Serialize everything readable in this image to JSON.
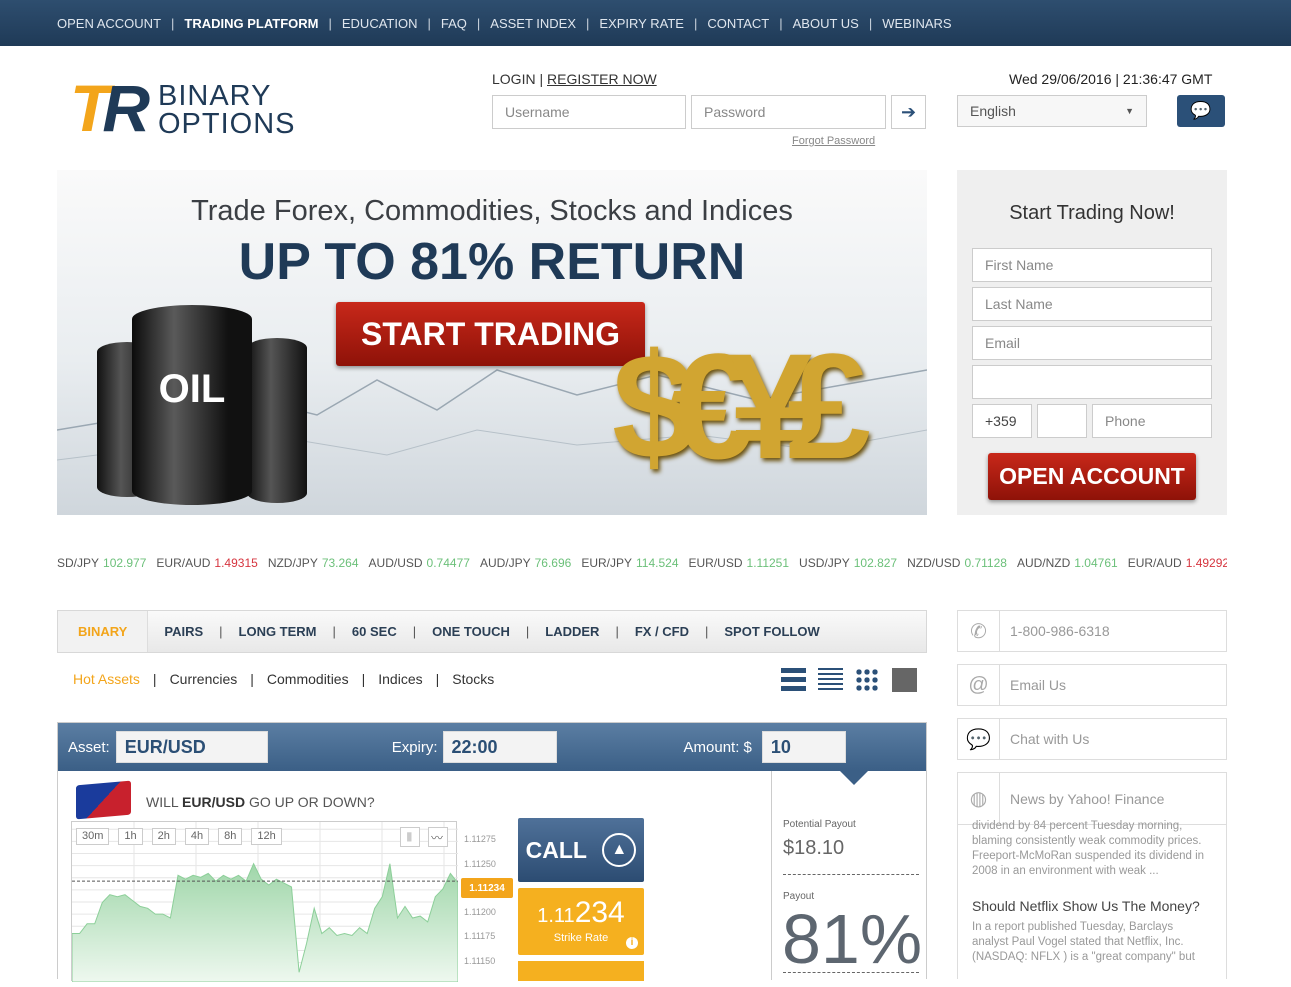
{
  "nav": {
    "items": [
      "OPEN ACCOUNT",
      "TRADING PLATFORM",
      "EDUCATION",
      "FAQ",
      "ASSET INDEX",
      "EXPIRY RATE",
      "CONTACT",
      "ABOUT US",
      "WEBINARS"
    ],
    "active": "TRADING PLATFORM"
  },
  "logo": {
    "mark": "TR",
    "line1": "BINARY",
    "line2": "OPTIONS"
  },
  "login": {
    "login_label": "LOGIN",
    "register_label": "REGISTER NOW",
    "username_placeholder": "Username",
    "password_placeholder": "Password",
    "forgot": "Forgot Password"
  },
  "header": {
    "datetime": "Wed 29/06/2016 | 21:36:47 GMT",
    "language": "English"
  },
  "banner": {
    "headline": "Trade Forex, Commodities, Stocks and Indices",
    "return": "UP TO 81% RETURN",
    "cta": "START TRADING",
    "oil_label": "OIL"
  },
  "signup": {
    "title": "Start Trading Now!",
    "first_name": "First Name",
    "last_name": "Last Name",
    "email": "Email",
    "country_code": "+359",
    "phone": "Phone",
    "submit": "OPEN ACCOUNT"
  },
  "ticker": [
    {
      "pair": "SD/JPY",
      "rate": "102.977",
      "dir": "up"
    },
    {
      "pair": "EUR/AUD",
      "rate": "1.49315",
      "dir": "dn"
    },
    {
      "pair": "NZD/JPY",
      "rate": "73.264",
      "dir": "up"
    },
    {
      "pair": "AUD/USD",
      "rate": "0.74477",
      "dir": "up"
    },
    {
      "pair": "AUD/JPY",
      "rate": "76.696",
      "dir": "up"
    },
    {
      "pair": "EUR/JPY",
      "rate": "114.524",
      "dir": "up"
    },
    {
      "pair": "EUR/USD",
      "rate": "1.11251",
      "dir": "up"
    },
    {
      "pair": "USD/JPY",
      "rate": "102.827",
      "dir": "up"
    },
    {
      "pair": "NZD/USD",
      "rate": "0.71128",
      "dir": "up"
    },
    {
      "pair": "AUD/NZD",
      "rate": "1.04761",
      "dir": "up"
    },
    {
      "pair": "EUR/AUD",
      "rate": "1.49292",
      "dir": "dn"
    }
  ],
  "tabs": [
    "BINARY",
    "PAIRS",
    "LONG TERM",
    "60 SEC",
    "ONE TOUCH",
    "LADDER",
    "FX / CFD",
    "SPOT FOLLOW"
  ],
  "subtabs": [
    "Hot Assets",
    "Currencies",
    "Commodities",
    "Indices",
    "Stocks"
  ],
  "trade": {
    "asset_label": "Asset:",
    "asset": "EUR/USD",
    "expiry_label": "Expiry:",
    "expiry": "22:00",
    "amount_label": "Amount: $",
    "amount": "10",
    "question_pre": "WILL ",
    "question_asset": "EUR/USD",
    "question_post": " GO UP OR DOWN?",
    "timeframes": [
      "30m",
      "1h",
      "2h",
      "4h",
      "8h",
      "12h"
    ],
    "y_ticks": [
      "1.11275",
      "1.11250",
      "1.11200",
      "1.11175",
      "1.11150"
    ],
    "current_rate": "1.11234",
    "call": "CALL",
    "strike_big": "234",
    "strike_small": "1.11",
    "strike_label": "Strike Rate",
    "potential_label": "Potential Payout",
    "potential": "$18.10",
    "payout_label": "Payout",
    "payout": "81%"
  },
  "chart_series": [
    1.1118,
    1.1118,
    1.1119,
    1.1119,
    1.11212,
    1.1122,
    1.11218,
    1.1122,
    1.11214,
    1.11208,
    1.11206,
    1.112,
    1.112,
    1.11196,
    1.1124,
    1.11236,
    1.1124,
    1.11238,
    1.11242,
    1.11234,
    1.1124,
    1.11236,
    1.1124,
    1.11234,
    1.11252,
    1.11236,
    1.1123,
    1.11236,
    1.11232,
    1.11228,
    1.1114,
    1.1117,
    1.11206,
    1.1118,
    1.11186,
    1.11178,
    1.1118,
    1.11178,
    1.11186,
    1.1118,
    1.11206,
    1.11218,
    1.11252,
    1.11196,
    1.11208,
    1.11196,
    1.11198,
    1.11192,
    1.11218,
    1.11226,
    1.11242,
    1.11232
  ],
  "contact": {
    "phone": "1-800-986-6318",
    "email": "Email Us",
    "chat": "Chat with Us",
    "news_title": "News by Yahoo! Finance"
  },
  "news": [
    {
      "title": "",
      "body": "dividend by 84 percent Tuesday morning, blaming consistently weak commodity prices. Freeport-McMoRan suspended its dividend in 2008 in an environment with weak ..."
    },
    {
      "title": "Should Netflix Show Us The Money?",
      "body": "In a report published Tuesday, Barclays analyst Paul Vogel stated that Netflix, Inc. (NASDAQ: NFLX ) is a \"great company\" but"
    }
  ],
  "colors": {
    "navy": "#1f3a57",
    "accent": "#f3a51b",
    "up": "#6cc07a",
    "down": "#d6353f",
    "cta_red": "#b01f12"
  }
}
